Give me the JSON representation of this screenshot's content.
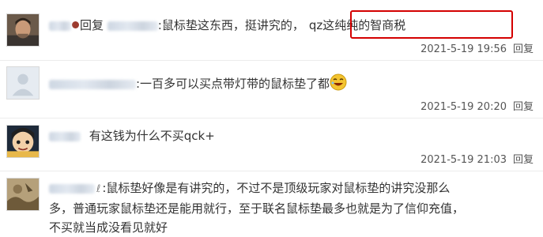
{
  "comments": [
    {
      "reply_word": "回复",
      "quoted_text": ":鼠标垫这东西，挺讲究的，",
      "text": "qz这纯纯的智商税",
      "date": "2021-5-19 19:56",
      "reply_label": "回复"
    },
    {
      "text": ":一百多可以买点带灯带的鼠标垫了都",
      "date": "2021-5-19 20:20",
      "reply_label": "回复",
      "emoji": "laughing-face-icon"
    },
    {
      "text": "有这钱为什么不买qck+",
      "date": "2021-5-19 21:03",
      "reply_label": "回复"
    },
    {
      "lines": [
        ":鼠标垫好像是有讲究的，不过不是顶级玩家对鼠标垫的讲究没那么",
        "多，普通玩家鼠标垫还是能用就行，至于联名鼠标垫最多也就是为了信仰充值，",
        "不买就当成没看见就好"
      ]
    }
  ],
  "colors": {
    "highlight": "#d40000",
    "text": "#333333",
    "meta": "#555555"
  }
}
